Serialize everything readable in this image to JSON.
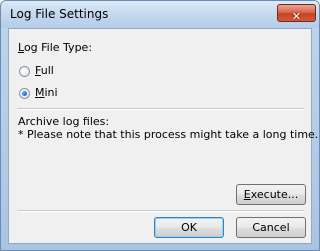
{
  "window": {
    "title": "Log File Settings",
    "close_icon": "close-icon",
    "close_glyph": "✕",
    "close_color": "#c74325"
  },
  "log_file_type": {
    "label_mnemonic": "L",
    "label_rest": "og File Type:",
    "options": [
      {
        "mnemonic": "F",
        "rest": "ull",
        "selected": false
      },
      {
        "mnemonic": "M",
        "rest": "ini",
        "selected": true
      }
    ]
  },
  "archive": {
    "heading": "Archive log files:",
    "note": "* Please note that this process might take a long time."
  },
  "buttons": {
    "execute_mnemonic": "E",
    "execute_rest": "xecute...",
    "ok": "OK",
    "cancel": "Cancel"
  }
}
